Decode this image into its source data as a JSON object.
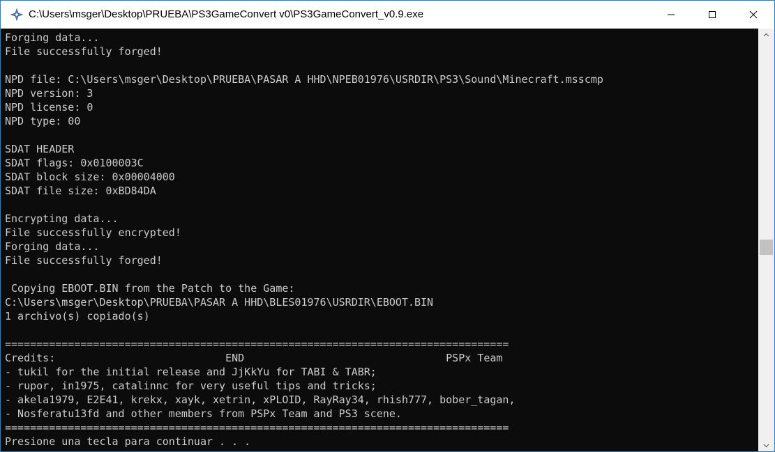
{
  "window": {
    "title": "C:\\Users\\msger\\Desktop\\PRUEBA\\PS3GameConvert v0\\PS3GameConvert_v0.9.exe"
  },
  "console": {
    "lines": [
      "Forging data...",
      "File successfully forged!",
      "",
      "NPD file: C:\\Users\\msger\\Desktop\\PRUEBA\\PASAR A HHD\\NPEB01976\\USRDIR\\PS3\\Sound\\Minecraft.msscmp",
      "NPD version: 3",
      "NPD license: 0",
      "NPD type: 00",
      "",
      "SDAT HEADER",
      "SDAT flags: 0x0100003C",
      "SDAT block size: 0x00004000",
      "SDAT file size: 0xBD84DA",
      "",
      "Encrypting data...",
      "File successfully encrypted!",
      "Forging data...",
      "File successfully forged!",
      "",
      " Copying EBOOT.BIN from the Patch to the Game:",
      "C:\\Users\\msger\\Desktop\\PRUEBA\\PASAR A HHD\\BLES01976\\USRDIR\\EBOOT.BIN",
      "1 archivo(s) copiado(s)",
      "",
      "================================================================================",
      "Credits:                           END                                PSPx Team",
      "- tukil for the initial release and JjKkYu for TABI & TABR;",
      "- rupor, in1975, catalinnc for very useful tips and tricks;",
      "- akela1979, E2E41, krekx, xayk, xetrin, xPLOID, RayRay34, rhish777, bober_tagan,",
      "- Nosferatu13fd and other members from PSPx Team and PS3 scene.",
      "================================================================================",
      "Presione una tecla para continuar . . ."
    ]
  }
}
